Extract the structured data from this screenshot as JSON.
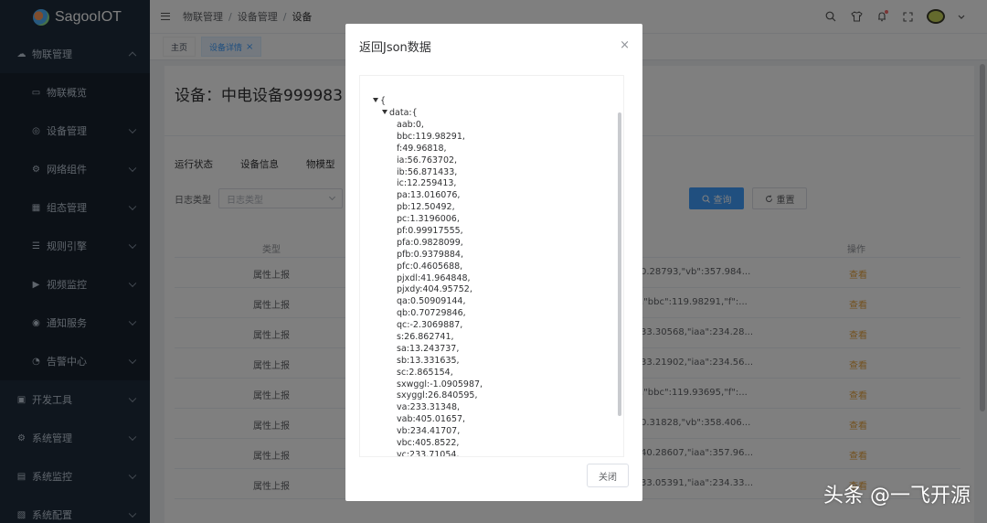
{
  "app": {
    "name": "SagooIOT"
  },
  "sidebar": {
    "items": [
      {
        "label": "物联管理",
        "level": "top",
        "icon": "cloud-icon",
        "expanded": true
      },
      {
        "label": "物联概览",
        "level": "sub",
        "icon": "monitor-icon"
      },
      {
        "label": "设备管理",
        "level": "sub",
        "icon": "device-icon",
        "chevron": true
      },
      {
        "label": "网络组件",
        "level": "sub",
        "icon": "network-icon",
        "chevron": true
      },
      {
        "label": "组态管理",
        "level": "sub",
        "icon": "layout-icon",
        "chevron": true
      },
      {
        "label": "规则引擎",
        "level": "sub",
        "icon": "rule-icon",
        "chevron": true
      },
      {
        "label": "视频监控",
        "level": "sub",
        "icon": "video-icon",
        "chevron": true
      },
      {
        "label": "通知服务",
        "level": "sub",
        "icon": "broadcast-icon",
        "chevron": true
      },
      {
        "label": "告警中心",
        "level": "sub",
        "icon": "alarm-icon",
        "chevron": true
      },
      {
        "label": "开发工具",
        "level": "top",
        "icon": "tool-icon",
        "chevron": true
      },
      {
        "label": "系统管理",
        "level": "top",
        "icon": "gear-icon",
        "chevron": true
      },
      {
        "label": "系统监控",
        "level": "top",
        "icon": "screen-icon",
        "chevron": true
      },
      {
        "label": "系统配置",
        "level": "top",
        "icon": "config-icon",
        "chevron": true
      }
    ]
  },
  "header": {
    "breadcrumb": [
      "物联管理",
      "设备管理",
      "设备"
    ],
    "icons": [
      "search-icon",
      "shirt-icon",
      "bell-icon",
      "fullscreen-icon"
    ]
  },
  "tags": [
    {
      "label": "主页",
      "active": false
    },
    {
      "label": "设备详情",
      "active": true,
      "close": "×"
    }
  ],
  "page": {
    "device_title": "设备：中电设备999983",
    "subtabs": [
      "运行状态",
      "设备信息",
      "物模型"
    ],
    "filter_label": "日志类型",
    "filter_placeholder": "日志类型",
    "query_button": "查询",
    "reset_button": "重置",
    "table": {
      "columns": {
        "type": "类型",
        "op": "操作"
      },
      "rows": [
        {
          "type": "属性上报",
          "content": "0.28793,\"vb\":357.984...",
          "op": "查看"
        },
        {
          "type": "属性上报",
          "content": ",\"bbc\":119.98291,\"f\":...",
          "op": "查看"
        },
        {
          "type": "属性上报",
          "content": "33.30568,\"iaa\":234.28...",
          "op": "查看"
        },
        {
          "type": "属性上报",
          "content": "33.21902,\"iaa\":234.56...",
          "op": "查看"
        },
        {
          "type": "属性上报",
          "content": ",\"bbc\":119.93695,\"f\":...",
          "op": "查看"
        },
        {
          "type": "属性上报",
          "content": "0.31828,\"vb\":358.406...",
          "op": "查看"
        },
        {
          "type": "属性上报",
          "content": "40.28607,\"iaa\":357.96...",
          "op": "查看"
        },
        {
          "type": "属性上报",
          "content": "33.05391,\"iaa\":234.33...",
          "op": "查看"
        }
      ]
    }
  },
  "dialog": {
    "title": "返回Json数据",
    "close_icon": "×",
    "root_open": "{",
    "data_key": "data:{",
    "lines": [
      "aab:0,",
      "bbc:119.98291,",
      "f:49.96818,",
      "ia:56.763702,",
      "ib:56.871433,",
      "ic:12.259413,",
      "pa:13.016076,",
      "pb:12.50492,",
      "pc:1.3196006,",
      "pf:0.99917555,",
      "pfa:0.9828099,",
      "pfb:0.9379884,",
      "pfc:0.4605688,",
      "pjxdl:41.964848,",
      "pjxdy:404.95752,",
      "qa:0.50909144,",
      "qb:0.70729846,",
      "qc:-2.3069887,",
      "s:26.862741,",
      "sa:13.243737,",
      "sb:13.331635,",
      "sc:2.865154,",
      "sxwggl:-1.0905987,",
      "sxyggl:26.840595,",
      "va:233.31348,",
      "vab:405.01657,",
      "vb:234.41707,",
      "vbc:405.8522,",
      "vc:233.71054,"
    ],
    "close_button": "关闭"
  },
  "watermark": "头条 @一飞开源"
}
